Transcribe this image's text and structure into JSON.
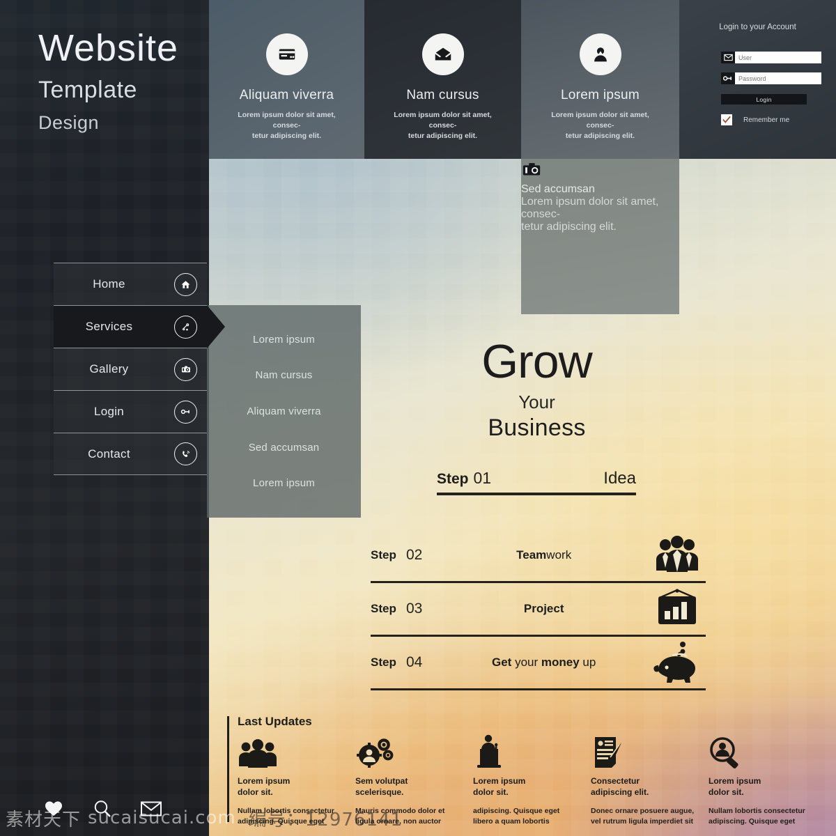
{
  "brand": {
    "line1": "Website",
    "line2": "Template",
    "line3": "Design"
  },
  "cards": [
    {
      "icon": "credit-card-icon",
      "title": "Aliquam viverra",
      "desc": "Lorem ipsum dolor sit amet, consec-\ntetur adipiscing elit."
    },
    {
      "icon": "open-envelope-icon",
      "title": "Nam cursus",
      "desc": "Lorem ipsum dolor sit amet, consec-\ntetur adipiscing elit."
    },
    {
      "icon": "user-avatar-icon",
      "title": "Lorem ipsum",
      "desc": "Lorem ipsum dolor sit amet, consec-\ntetur adipiscing elit."
    },
    {
      "icon": "camera-icon",
      "title": "Sed accumsan",
      "desc": "Lorem ipsum dolor sit amet, consec-\ntetur adipiscing elit."
    }
  ],
  "login": {
    "title": "Login to your Account",
    "user_placeholder": "User",
    "password_placeholder": "Password",
    "user_value": "",
    "password_value": "",
    "button_label": "Login",
    "remember_label": "Remember me",
    "remember_checked": true,
    "user_icon": "envelope-icon",
    "password_icon": "key-icon",
    "check_color": "#a14b38"
  },
  "nav": {
    "items": [
      {
        "label": "Home",
        "icon": "home-icon",
        "active": false
      },
      {
        "label": "Services",
        "icon": "services-gear-icon",
        "active": true
      },
      {
        "label": "Gallery",
        "icon": "camera-icon",
        "active": false
      },
      {
        "label": "Login",
        "icon": "key-icon",
        "active": false
      },
      {
        "label": "Contact",
        "icon": "phone-icon",
        "active": false
      }
    ]
  },
  "submenu": {
    "items": [
      "Lorem ipsum",
      "Nam cursus",
      "Aliquam viverra",
      "Sed accumsan",
      "Lorem ipsum"
    ]
  },
  "hero": {
    "line1": "Grow",
    "line2": "Your",
    "line3": "Business"
  },
  "step01": {
    "label": "Step",
    "number": "01",
    "text": "Idea"
  },
  "steps": [
    {
      "label": "Step",
      "number": "02",
      "title_plain": "Team",
      "title_light": "work",
      "icon": "team-group-icon"
    },
    {
      "label": "Step",
      "number": "03",
      "title_plain": "Project",
      "title_light": "",
      "icon": "presentation-chart-icon"
    },
    {
      "label": "Step",
      "number": "04",
      "title_parts": "Get your money up",
      "icon": "piggy-bank-icon"
    }
  ],
  "step_titles": {
    "s2_a": "Team",
    "s2_b": "work",
    "s3_a": "Project",
    "s4_a": "Get",
    "s4_b": "your",
    "s4_c": "money",
    "s4_d": "up"
  },
  "updates": {
    "heading": "Last Updates",
    "columns": [
      {
        "icon": "team-group-icon",
        "title": "Lorem ipsum\ndolor sit.",
        "body": "Nullam lobortis consectetur\nadipiscing. Quisque eget"
      },
      {
        "icon": "gears-user-icon",
        "title": "Sem volutpat\nscelerisque.",
        "body": "Mauris commodo dolor et\nligula ornare, non auctor"
      },
      {
        "icon": "presenter-podium-icon",
        "title": "Lorem ipsum\ndolor sit.",
        "body": "adipiscing. Quisque eget\nlibero a quam lobortis"
      },
      {
        "icon": "profile-document-edit-icon",
        "title": "Consectetur\nadipiscing elit.",
        "body": "Donec ornare posuere augue,\nvel rutrum ligula imperdiet sit"
      },
      {
        "icon": "user-search-icon",
        "title": "Lorem ipsum\ndolor sit.",
        "body": "Nullam lobortis consectetur\nadipiscing. Quisque eget"
      }
    ]
  },
  "social": [
    {
      "icon": "heart-icon"
    },
    {
      "icon": "search-icon"
    },
    {
      "icon": "envelope-icon"
    }
  ],
  "watermark": {
    "text_left": "素材天下",
    "text_mid": "sucaisucai.com",
    "text_right": "编号：12976141"
  },
  "colors": {
    "dark_panel": "#20242a",
    "card_dark": "#2b3036",
    "accent_dark": "#17191c",
    "text_light": "#e8ecef"
  }
}
